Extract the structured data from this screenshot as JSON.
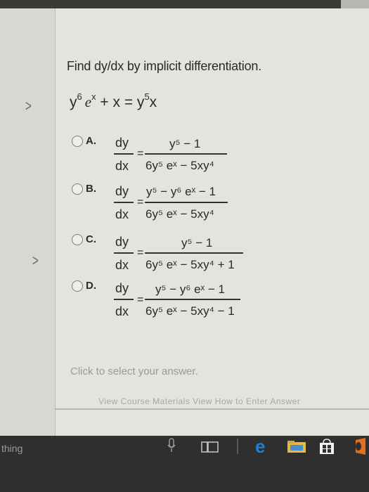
{
  "question": {
    "prompt": "Find dy/dx by implicit differentiation.",
    "equation": {
      "lhs_y": "y",
      "lhs_y_exp": "6",
      "lhs_e": "e",
      "lhs_e_exp": "x",
      "middle": " + x = y",
      "rhs_exp": "5",
      "rhs_tail": "x"
    }
  },
  "options": [
    {
      "letter": "A.",
      "dy": "dy",
      "dx": "dx",
      "eq": "=",
      "num": "y⁵ − 1",
      "den": "6y⁵ eˣ − 5xy⁴"
    },
    {
      "letter": "B.",
      "dy": "dy",
      "dx": "dx",
      "eq": "=",
      "num": "y⁵ − y⁶ eˣ − 1",
      "den": "6y⁵ eˣ − 5xy⁴"
    },
    {
      "letter": "C.",
      "dy": "dy",
      "dx": "dx",
      "eq": "=",
      "num": "y⁵ − 1",
      "den": "6y⁵ eˣ − 5xy⁴ + 1"
    },
    {
      "letter": "D.",
      "dy": "dy",
      "dx": "dx",
      "eq": "=",
      "num": "y⁵ − y⁶ eˣ − 1",
      "den": "6y⁵ eˣ − 5xy⁴ − 1"
    }
  ],
  "footer": {
    "select_hint": "Click to select your answer.",
    "links": "View Course Materials    View How to Enter Answer"
  },
  "taskbar": {
    "search_text": "thing"
  },
  "colors": {
    "panel": "#e4e3de",
    "taskbar": "#2f2f2f",
    "edge_accent": "#1e7fd6",
    "office_orange": "#e0701e"
  }
}
